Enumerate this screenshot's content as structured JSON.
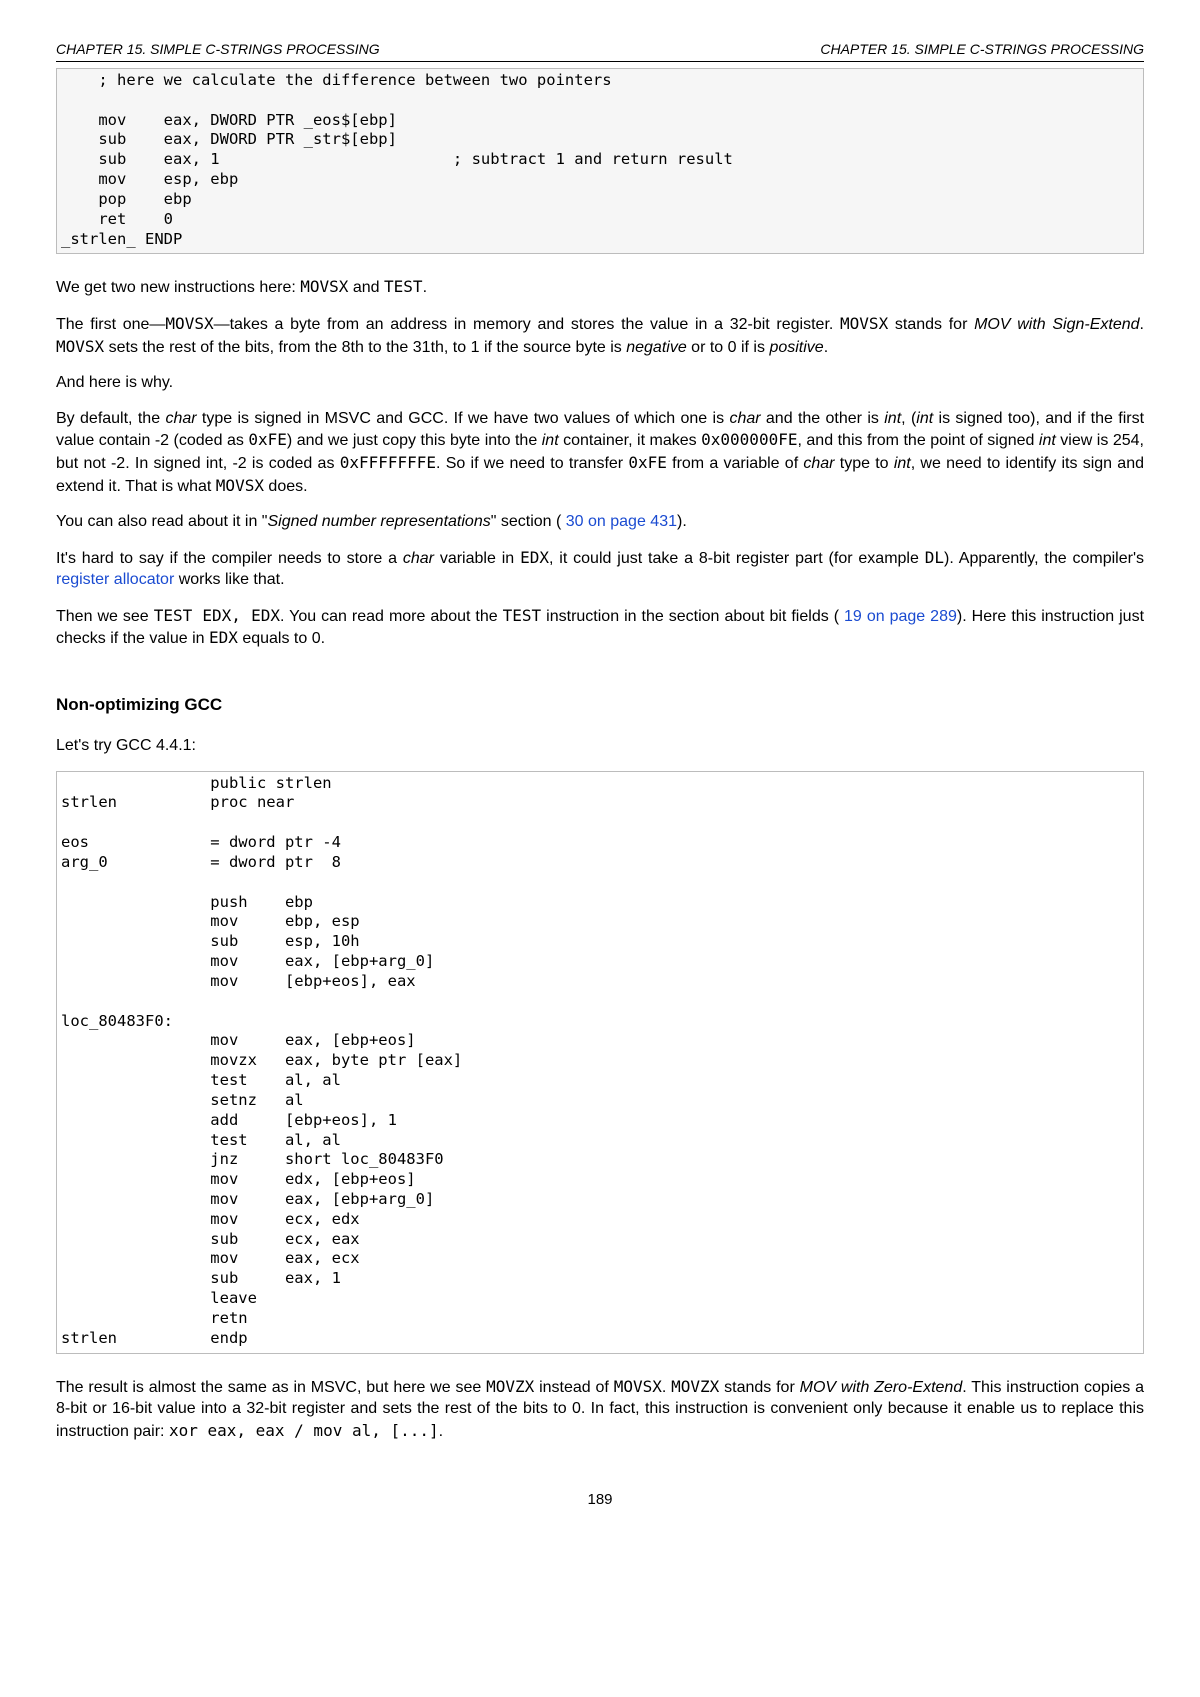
{
  "header": {
    "left": "CHAPTER 15.  SIMPLE C-STRINGS PROCESSING",
    "right": "CHAPTER 15.  SIMPLE C-STRINGS PROCESSING"
  },
  "code1": "    ; here we calculate the difference between two pointers\n\n    mov    eax, DWORD PTR _eos$[ebp]\n    sub    eax, DWORD PTR _str$[ebp]\n    sub    eax, 1                         ; subtract 1 and return result\n    mov    esp, ebp\n    pop    ebp\n    ret    0\n_strlen_ ENDP",
  "p1_a": "We get two new instructions here: ",
  "p1_b": "MOVSX",
  "p1_c": " and ",
  "p1_d": "TEST",
  "p1_e": ".",
  "p2_a": "The first one—",
  "p2_b": "MOVSX",
  "p2_c": "—takes a byte from an address in memory and stores the value in a 32-bit register. ",
  "p2_d": "MOVSX",
  "p2_e": " stands for ",
  "p2_f": "MOV with Sign-Extend",
  "p2_g": ". ",
  "p2_h": "MOVSX",
  "p2_i": " sets the rest of the bits, from the 8th to the 31th, to 1 if the source byte is ",
  "p2_j": "negative",
  "p2_k": " or to 0 if is ",
  "p2_l": "positive",
  "p2_m": ".",
  "p3": "And here is why.",
  "p4_a": "By default, the ",
  "p4_b": "char",
  "p4_c": " type is signed in MSVC and GCC. If we have two values of which one is ",
  "p4_d": "char",
  "p4_e": " and the other is ",
  "p4_f": "int",
  "p4_g": ", (",
  "p4_h": "int",
  "p4_i": " is signed too), and if the first value contain -2 (coded as ",
  "p4_j": "0xFE",
  "p4_k": ") and we just copy this byte into the ",
  "p4_l": "int",
  "p4_m": " container, it makes ",
  "p4_n": "0x000000FE",
  "p4_o": ", and this from the point of signed ",
  "p4_p": "int",
  "p4_q": " view is 254, but not -2. In signed int, -2 is coded as ",
  "p4_r": "0xFFFFFFFE",
  "p4_s": ". So if we need to transfer ",
  "p4_t": "0xFE",
  "p4_u": " from a variable of ",
  "p4_v": "char",
  "p4_w": " type to ",
  "p4_x": "int",
  "p4_y": ", we need to identify its sign and extend it. That is what ",
  "p4_z": "MOVSX",
  "p4_zz": " does.",
  "p5_a": "You can also read about it in \"",
  "p5_b": "Signed number representations",
  "p5_c": "\" section ( ",
  "p5_d": "30 on page 431",
  "p5_e": ").",
  "p6_a": "It's hard to say if the compiler needs to store a ",
  "p6_b": "char",
  "p6_c": " variable in ",
  "p6_d": "EDX",
  "p6_e": ", it could just take a 8-bit register part (for example ",
  "p6_f": "DL",
  "p6_g": "). Apparently, the compiler's ",
  "p6_h": "register allocator",
  "p6_i": " works like that.",
  "p7_a": "Then we see ",
  "p7_b": "TEST EDX, EDX",
  "p7_c": ". You can read more about the ",
  "p7_d": "TEST",
  "p7_e": " instruction in the section about bit fields ( ",
  "p7_f": "19 on page 289",
  "p7_g": "). Here this instruction just checks if the value in ",
  "p7_h": "EDX",
  "p7_i": " equals to 0.",
  "subheading": "Non-optimizing GCC",
  "p8": "Let's try GCC 4.4.1:",
  "code2": "                public strlen\nstrlen          proc near\n\neos             = dword ptr -4\narg_0           = dword ptr  8\n\n                push    ebp\n                mov     ebp, esp\n                sub     esp, 10h\n                mov     eax, [ebp+arg_0]\n                mov     [ebp+eos], eax\n\nloc_80483F0:\n                mov     eax, [ebp+eos]\n                movzx   eax, byte ptr [eax]\n                test    al, al\n                setnz   al\n                add     [ebp+eos], 1\n                test    al, al\n                jnz     short loc_80483F0\n                mov     edx, [ebp+eos]\n                mov     eax, [ebp+arg_0]\n                mov     ecx, edx\n                sub     ecx, eax\n                mov     eax, ecx\n                sub     eax, 1\n                leave\n                retn\nstrlen          endp",
  "p9_a": "The result is almost the same as in MSVC, but here we see ",
  "p9_b": "MOVZX",
  "p9_c": " instead of ",
  "p9_d": "MOVSX",
  "p9_e": ". ",
  "p9_f": "MOVZX",
  "p9_g": " stands for ",
  "p9_h": "MOV with Zero-Extend",
  "p9_i": ". This instruction copies a 8-bit or 16-bit value into a 32-bit register and sets the rest of the bits to 0. In fact, this instruction is convenient only because it enable us to replace this instruction pair: ",
  "p9_j": "xor eax, eax / mov al, [...]",
  "p9_k": ".",
  "pagenum": "189"
}
